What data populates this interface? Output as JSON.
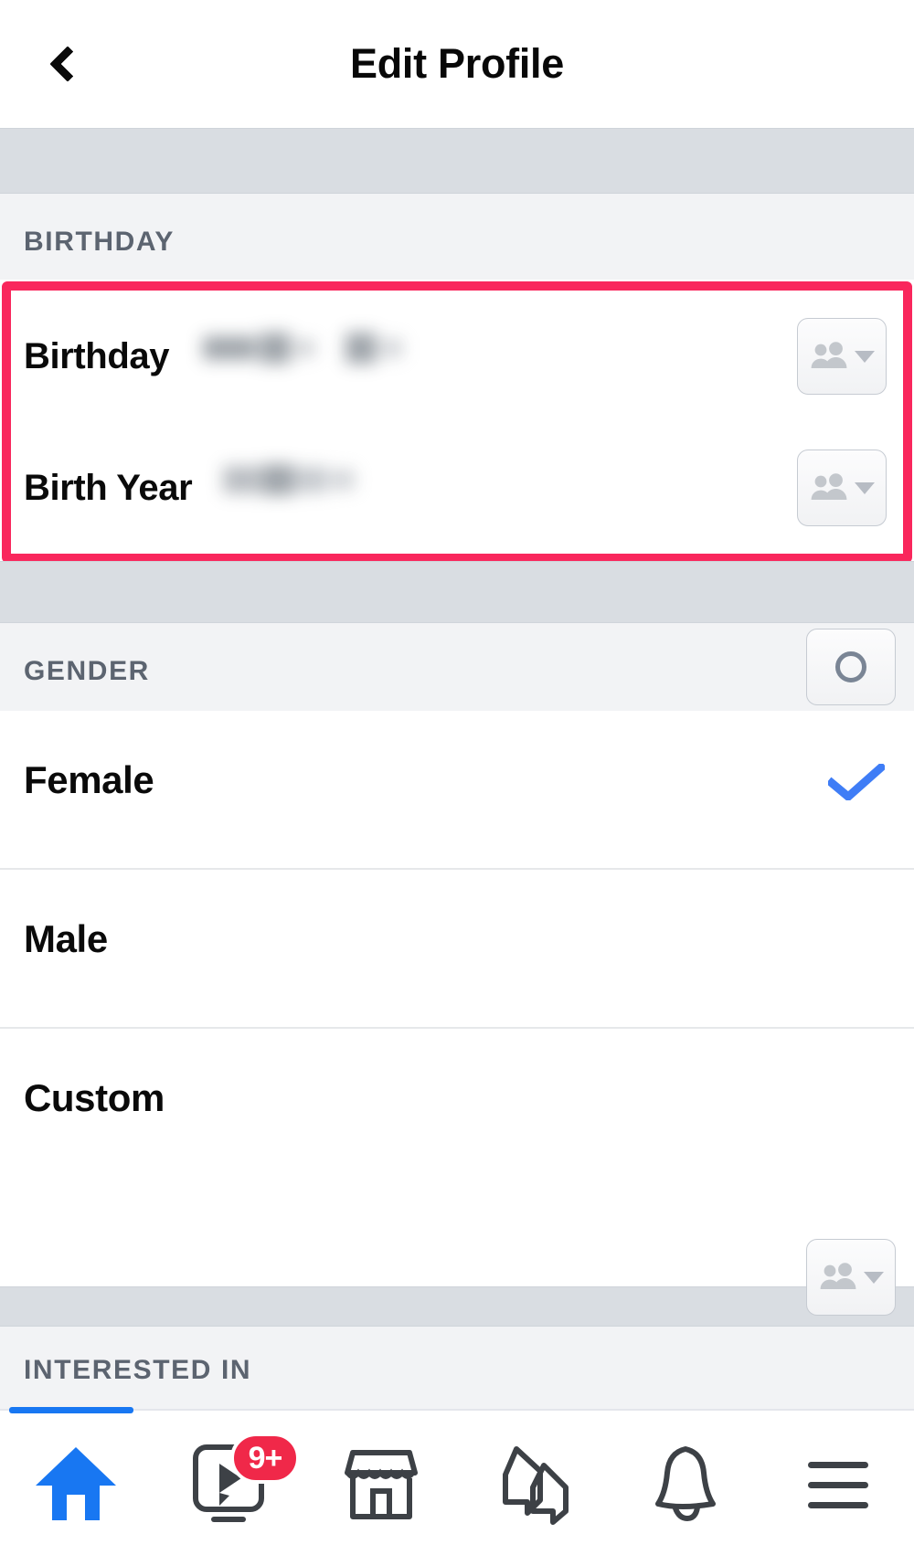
{
  "header": {
    "title": "Edit Profile",
    "back_icon": "chevron-left-icon"
  },
  "sections": {
    "birthday": {
      "header_label": "BIRTHDAY",
      "highlight_color": "#f9275c",
      "rows": [
        {
          "label": "Birthday",
          "value": "",
          "value_redacted": true,
          "privacy_icon": "friends-icon",
          "privacy_caret": "chevron-down-icon"
        },
        {
          "label": "Birth Year",
          "value": "",
          "value_redacted": true,
          "privacy_icon": "friends-icon",
          "privacy_caret": "chevron-down-icon"
        }
      ]
    },
    "gender": {
      "header_label": "GENDER",
      "privacy_icon": "globe-public-icon",
      "options": [
        {
          "label": "Female",
          "selected": true,
          "check_icon": "check-icon",
          "check_color": "#3f7df6"
        },
        {
          "label": "Male",
          "selected": false,
          "check_icon": "",
          "check_color": ""
        },
        {
          "label": "Custom",
          "selected": false,
          "check_icon": "",
          "check_color": ""
        }
      ]
    },
    "interested_in": {
      "header_label": "INTERESTED IN",
      "privacy_icon": "friends-icon",
      "privacy_caret": "chevron-down-icon"
    }
  },
  "bottom_nav": {
    "active_color": "#1877f2",
    "badge_color": "#f02849",
    "items": [
      {
        "name": "home",
        "icon": "home-icon",
        "active": true,
        "badge": ""
      },
      {
        "name": "watch",
        "icon": "watch-video-icon",
        "active": false,
        "badge": "9+"
      },
      {
        "name": "marketplace",
        "icon": "store-icon",
        "active": false,
        "badge": ""
      },
      {
        "name": "groups",
        "icon": "groups-bubbles-icon",
        "active": false,
        "badge": ""
      },
      {
        "name": "notifications",
        "icon": "bell-icon",
        "active": false,
        "badge": ""
      },
      {
        "name": "menu",
        "icon": "hamburger-menu-icon",
        "active": false,
        "badge": ""
      }
    ]
  }
}
